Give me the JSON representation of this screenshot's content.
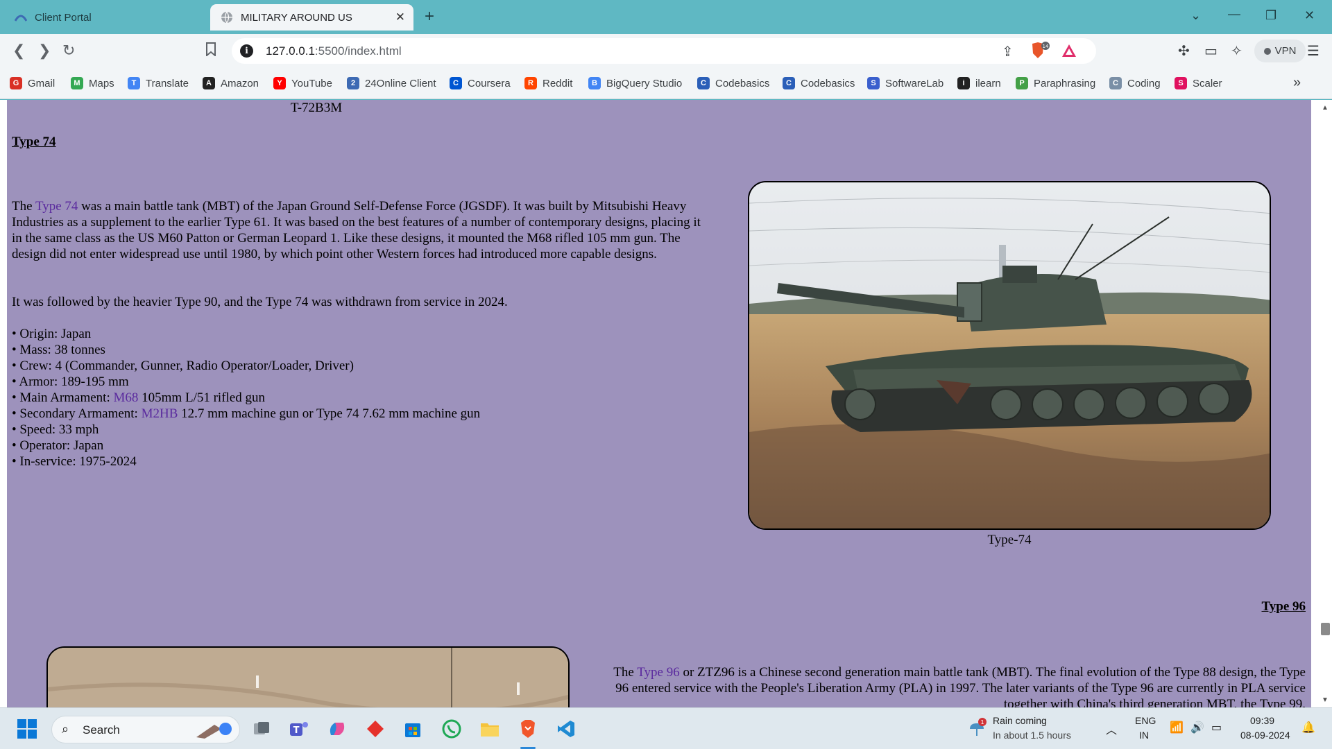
{
  "browser": {
    "tabs": [
      {
        "label": "Client Portal",
        "active": false
      },
      {
        "label": "MILITARY AROUND US",
        "active": true
      }
    ],
    "url_host": "127.0.0.1",
    "url_rest": ":5500/index.html",
    "vpn_label": "VPN",
    "shield_count": "14",
    "bookmarks": [
      {
        "label": "Gmail",
        "icon": "gmail-icon",
        "color": "#d93025"
      },
      {
        "label": "Maps",
        "icon": "maps-pin-icon",
        "color": "#34a853"
      },
      {
        "label": "Translate",
        "icon": "translate-icon",
        "color": "#4285f4"
      },
      {
        "label": "Amazon",
        "icon": "amazon-icon",
        "color": "#222222"
      },
      {
        "label": "YouTube",
        "icon": "youtube-icon",
        "color": "#ff0000"
      },
      {
        "label": "24Online Client",
        "icon": "cloud-icon",
        "color": "#3d6ab3"
      },
      {
        "label": "Coursera",
        "icon": "coursera-icon",
        "color": "#0056d2"
      },
      {
        "label": "Reddit",
        "icon": "reddit-icon",
        "color": "#ff4500"
      },
      {
        "label": "BigQuery Studio",
        "icon": "bigquery-icon",
        "color": "#4285f4"
      },
      {
        "label": "Codebasics",
        "icon": "rocket-icon",
        "color": "#2b5fb8"
      },
      {
        "label": "Codebasics",
        "icon": "codebasics-icon",
        "color": "#2b5fb8"
      },
      {
        "label": "SoftwareLab",
        "icon": "softwarelab-icon",
        "color": "#3a5fcd"
      },
      {
        "label": "ilearn",
        "icon": "ilearn-icon",
        "color": "#222222"
      },
      {
        "label": "Paraphrasing",
        "icon": "paraphrasing-icon",
        "color": "#43a047"
      },
      {
        "label": "Coding",
        "icon": "coding-icon",
        "color": "#7a8fa6"
      },
      {
        "label": "Scaler",
        "icon": "scaler-icon",
        "color": "#e0115f"
      }
    ]
  },
  "page": {
    "prev_caption": "T-72B3M",
    "type74": {
      "heading": "Type 74",
      "para1_pre": "The ",
      "para1_link": "Type 74",
      "para1_post": " was a main battle tank (MBT) of the Japan Ground Self-Defense Force (JGSDF). It was built by Mitsubishi Heavy Industries as a supplement to the earlier Type 61. It was based on the best features of a number of contemporary designs, placing it in the same class as the US M60 Patton or German Leopard 1. Like these designs, it mounted the M68 rifled 105 mm gun. The design did not enter widespread use until 1980, by which point other Western forces had introduced more capable designs.",
      "para2": "It was followed by the heavier Type 90, and the Type 74 was withdrawn from service in 2024.",
      "specs": {
        "origin": "Origin: Japan",
        "mass": "Mass: 38 tonnes",
        "crew": "Crew: 4 (Commander, Gunner, Radio Operator/Loader, Driver)",
        "armor": "Armor: 189-195 mm",
        "main_pre": "Main Armament: ",
        "main_link": "M68",
        "main_post": " 105mm L/51 rifled gun",
        "secondary_pre": "Secondary Armament: ",
        "secondary_link": "M2HB",
        "secondary_post": " 12.7 mm machine gun or Type 74 7.62 mm machine gun",
        "speed": "Speed: 33 mph",
        "operator": "Operator: Japan",
        "in_service": "In-service: 1975-2024"
      },
      "image_caption": "Type-74"
    },
    "type96": {
      "heading": "Type 96",
      "para_pre": "The ",
      "para_link": "Type 96",
      "para_post": " or ZTZ96 is a Chinese second generation main battle tank (MBT). The final evolution of the Type 88 design, the Type 96 entered service with the People's Liberation Army (PLA) in 1997. The later variants of the Type 96 are currently in PLA service together with China's third generation MBT, the Type 99."
    }
  },
  "taskbar": {
    "search_label": "Search",
    "weather_title": "Rain coming",
    "weather_sub": "In about 1.5 hours",
    "weather_badge": "1",
    "lang_top": "ENG",
    "lang_bottom": "IN",
    "time": "09:39",
    "date": "08-09-2024"
  },
  "colors": {
    "page_bg": "#9d92bc",
    "link": "#5a2a9e",
    "browser_accent": "#5fb8c3"
  }
}
